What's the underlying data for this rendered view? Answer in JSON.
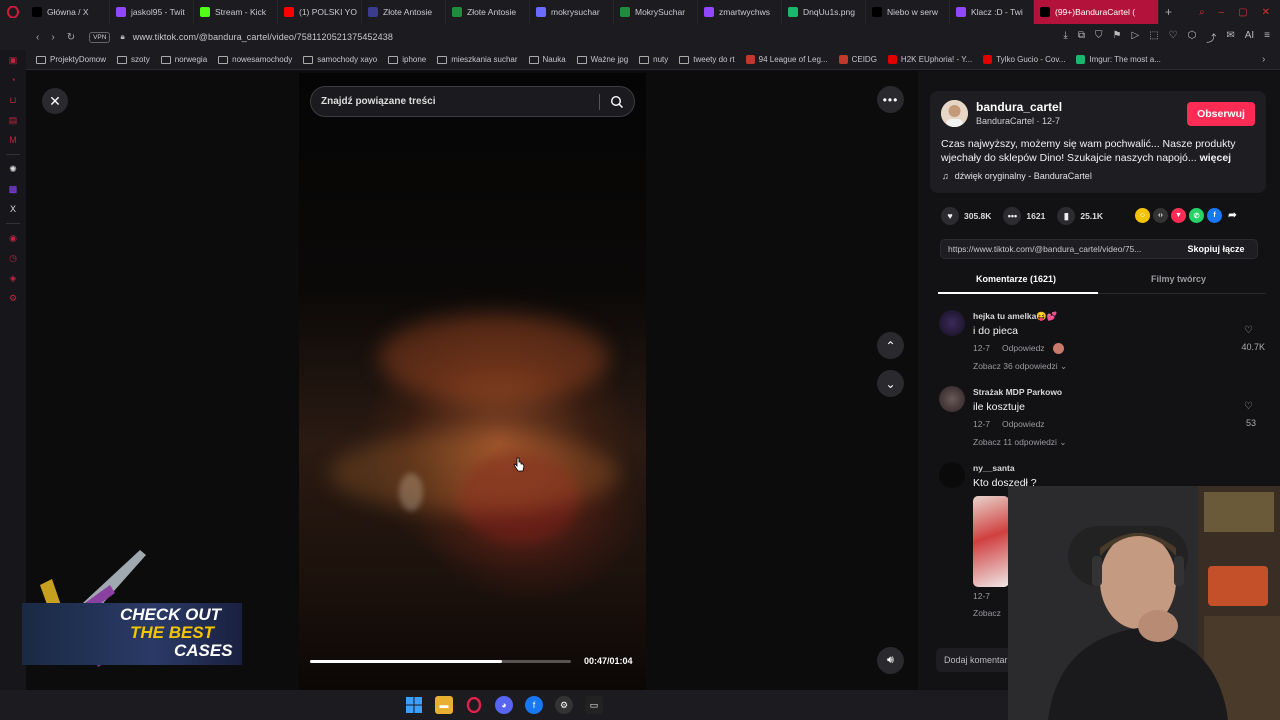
{
  "tabs": [
    {
      "label": "Główna / X",
      "icon": "x-logo-icon",
      "color": "#000000"
    },
    {
      "label": "jaskol95 - Twit",
      "icon": "twitch-icon",
      "color": "#9146ff"
    },
    {
      "label": "Stream - Kick",
      "icon": "kick-icon",
      "color": "#53fc18"
    },
    {
      "label": "(1) POLSKI YO",
      "icon": "youtube-icon",
      "color": "#ff0000"
    },
    {
      "label": "Złote Antosie",
      "icon": "site-icon",
      "color": "#3b3b8f"
    },
    {
      "label": "Złote Antosie",
      "icon": "sheets-icon",
      "color": "#1e8e3e"
    },
    {
      "label": "mokrysuchar",
      "icon": "circle-icon",
      "color": "#6b6bff"
    },
    {
      "label": "MokrySuchar",
      "icon": "t-icon",
      "color": "#1e8e3e"
    },
    {
      "label": "zmartwychws",
      "icon": "twitch-icon",
      "color": "#9146ff"
    },
    {
      "label": "DnqUu1s.png",
      "icon": "imgur-icon",
      "color": "#1bb76e"
    },
    {
      "label": "Niebo w serw",
      "icon": "x-logo-icon",
      "color": "#000000"
    },
    {
      "label": "Klacz :D - Twi",
      "icon": "twitch-icon",
      "color": "#9146ff"
    },
    {
      "label": "(99+)BanduraCartel (",
      "icon": "tiktok-icon",
      "color": "#000000",
      "active": true
    }
  ],
  "address": {
    "vpn": "VPN",
    "url": "www.tiktok.com/@bandura_cartel/video/7581120521375452438"
  },
  "bookmarks": [
    {
      "label": "ProjektyDomow",
      "type": "folder"
    },
    {
      "label": "szoty",
      "type": "folder"
    },
    {
      "label": "norwegia",
      "type": "folder"
    },
    {
      "label": "nowesamochody",
      "type": "folder"
    },
    {
      "label": "samochody xayo",
      "type": "folder"
    },
    {
      "label": "iphone",
      "type": "folder"
    },
    {
      "label": "mieszkania suchar",
      "type": "folder"
    },
    {
      "label": "Nauka",
      "type": "folder"
    },
    {
      "label": "Ważne jpg",
      "type": "folder"
    },
    {
      "label": "nuty",
      "type": "folder"
    },
    {
      "label": "tweety do rt",
      "type": "folder"
    },
    {
      "label": "94 League of Leg...",
      "type": "site",
      "color": "#c0392b"
    },
    {
      "label": "CEIDG",
      "type": "site",
      "color": "#c0392b"
    },
    {
      "label": "H2K EUphoria! - Y...",
      "type": "site",
      "color": "#e00000"
    },
    {
      "label": "Tylko Gucio - Cov...",
      "type": "site",
      "color": "#e00000"
    },
    {
      "label": "Imgur: The most a...",
      "type": "site",
      "color": "#1bb76e"
    }
  ],
  "search": {
    "placeholder": "Znajdź powiązane treści"
  },
  "video": {
    "progress": 0.734,
    "time": "00:47/01:04"
  },
  "ad": {
    "line1": "CHECK OUT",
    "line2": "THE BEST",
    "line3": "CASES"
  },
  "author": {
    "username": "bandura_cartel",
    "display": "BanduraCartel · 12-7",
    "follow": "Obserwuj",
    "description": "Czas najwyższy, możemy się wam pochwalić... Nasze produkty wjechały do sklepów Dino! Szukajcie naszych napojó...",
    "more": "więcej",
    "sound": "dźwięk oryginalny - BanduraCartel"
  },
  "stats": {
    "likes": "305.8K",
    "comments": "1621",
    "saves": "25.1K"
  },
  "share": {
    "link": "https://www.tiktok.com/@bandura_cartel/video/75...",
    "copy": "Skopiuj łącze"
  },
  "panel_tabs": {
    "comments": "Komentarze (1621)",
    "creator": "Filmy twórcy"
  },
  "comments": [
    {
      "name": "hejka tu amelka😝💕",
      "text": "i do pieca",
      "date": "12-7",
      "reply": "Odpowiedz",
      "replies": "Zobacz 36 odpowiedzi",
      "likes": "40.7K"
    },
    {
      "name": "Strażak MDP Parkowo",
      "text": "ile kosztuje",
      "date": "12-7",
      "reply": "Odpowiedz",
      "replies": "Zobacz 11 odpowiedzi",
      "likes": "53"
    },
    {
      "name": "ny__santa",
      "text": "Kto doszedł ?",
      "date": "12-7",
      "replies": "Zobacz"
    }
  ],
  "add_comment": "Dodaj komentarz",
  "colors": {
    "accent": "#fe2c55",
    "opera": "#c0243f"
  }
}
